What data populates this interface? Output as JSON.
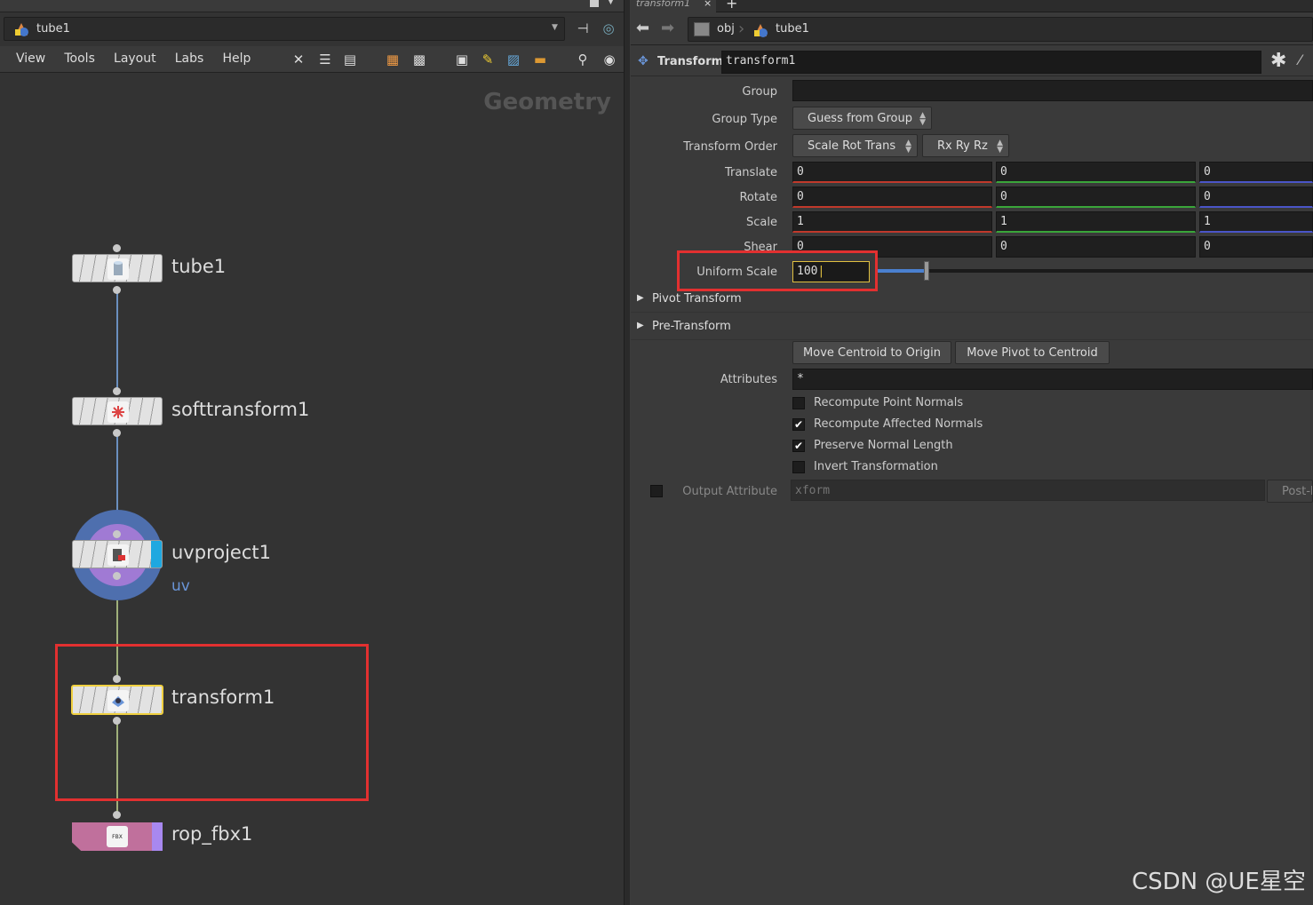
{
  "left": {
    "path_node": "tube1",
    "menu": [
      "View",
      "Tools",
      "Layout",
      "Labs",
      "Help"
    ],
    "context_label": "Geometry",
    "nodes": [
      {
        "name": "tube1",
        "icon": "tube-icon"
      },
      {
        "name": "softtransform1",
        "icon": "soft-transform-icon"
      },
      {
        "name": "uvproject1",
        "icon": "uv-project-icon",
        "sublabel": "uv"
      },
      {
        "name": "transform1",
        "icon": "transform-icon"
      },
      {
        "name": "rop_fbx1",
        "icon": "fbx-export-icon",
        "icon_text": "FBX"
      }
    ]
  },
  "right": {
    "tab_title": "transform1",
    "tab_close": "×",
    "tab_add": "+",
    "path": [
      "obj",
      "tube1"
    ],
    "node_type": "Transform",
    "node_name": "transform1",
    "params": {
      "group_label": "Group",
      "group_value": "",
      "group_type_label": "Group Type",
      "group_type_value": "Guess from Group",
      "xform_order_label": "Transform Order",
      "xform_order_value": "Scale Rot Trans",
      "rot_order_value": "Rx Ry Rz",
      "translate_label": "Translate",
      "translate": [
        "0",
        "0",
        "0"
      ],
      "rotate_label": "Rotate",
      "rotate": [
        "0",
        "0",
        "0"
      ],
      "scale_label": "Scale",
      "scale": [
        "1",
        "1",
        "1"
      ],
      "shear_label": "Shear",
      "shear": [
        "0",
        "0",
        "0"
      ],
      "uniform_scale_label": "Uniform Scale",
      "uniform_scale_value": "100",
      "pivot_transform": "Pivot Transform",
      "pre_transform": "Pre-Transform",
      "move_centroid_btn": "Move Centroid to Origin",
      "move_pivot_btn": "Move Pivot to Centroid",
      "attributes_label": "Attributes",
      "attributes_value": "*",
      "checkboxes": [
        {
          "label": "Recompute Point Normals",
          "checked": false
        },
        {
          "label": "Recompute Affected Normals",
          "checked": true
        },
        {
          "label": "Preserve Normal Length",
          "checked": true
        },
        {
          "label": "Invert Transformation",
          "checked": false
        }
      ],
      "output_attr_label": "Output Attribute",
      "output_attr_placeholder": "xform",
      "post_btn": "Post-M"
    }
  },
  "watermark": "CSDN @UE星空",
  "colors": {
    "x_axis": "#c0392b",
    "y_axis": "#3aa63a",
    "z_axis": "#4a55c8",
    "highlight": "#e23030",
    "selected": "#f0d040"
  }
}
